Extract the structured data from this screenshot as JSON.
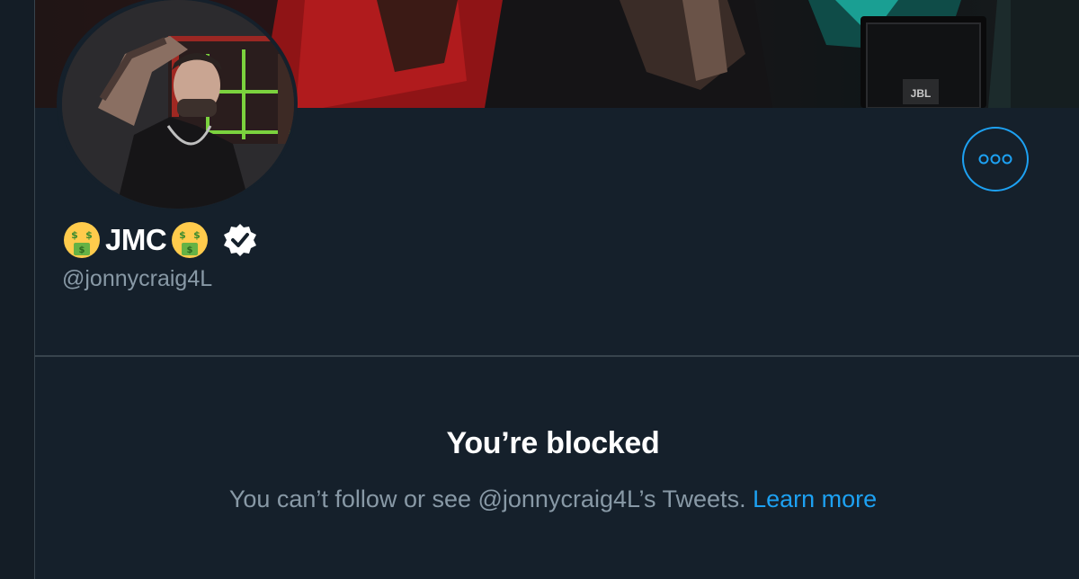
{
  "profile": {
    "display_name": "JMC",
    "name_emoji_left": "money-mouth-face",
    "name_emoji_right": "money-mouth-face",
    "verified": true,
    "handle": "@jonnycraig4L"
  },
  "blocked": {
    "title": "You’re blocked",
    "message": "You can’t follow or see @jonnycraig4L’s Tweets.",
    "learn_more": "Learn more"
  },
  "banner": {
    "amp_logo": "JBL"
  },
  "colors": {
    "background": "#15202b",
    "border": "#38444d",
    "accent": "#1da1f2",
    "secondary_text": "#8899a6",
    "primary_text": "#ffffff"
  },
  "icons": {
    "more": "more-horizontal-icon",
    "verified": "verified-badge-icon"
  }
}
